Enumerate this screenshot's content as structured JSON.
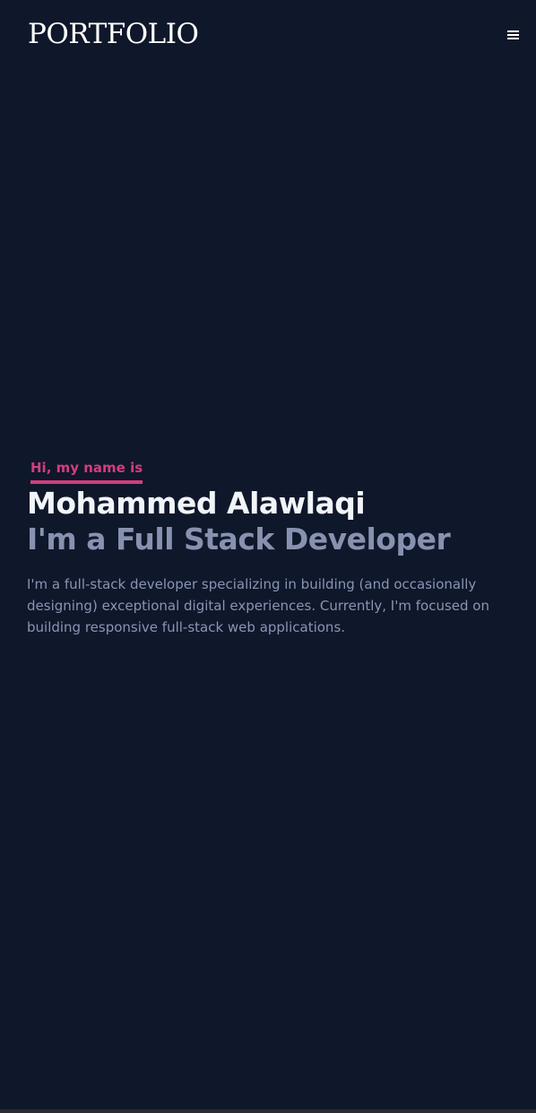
{
  "header": {
    "logo_text": "PORTFOLIO",
    "menu_icon": "hamburger-menu-icon"
  },
  "hero": {
    "greeting": "Hi, my name is",
    "name": "Mohammed Alawlaqi",
    "role": "I'm a Full Stack Developer",
    "bio": "I'm a full-stack developer specializing in building (and occasionally designing) exceptional digital experiences. Currently, I'm focused on building responsive full-stack web applications."
  },
  "colors": {
    "background": "#0f172a",
    "accent": "#d23e7c",
    "heading": "#f1f5f9",
    "muted": "#8991b0"
  }
}
